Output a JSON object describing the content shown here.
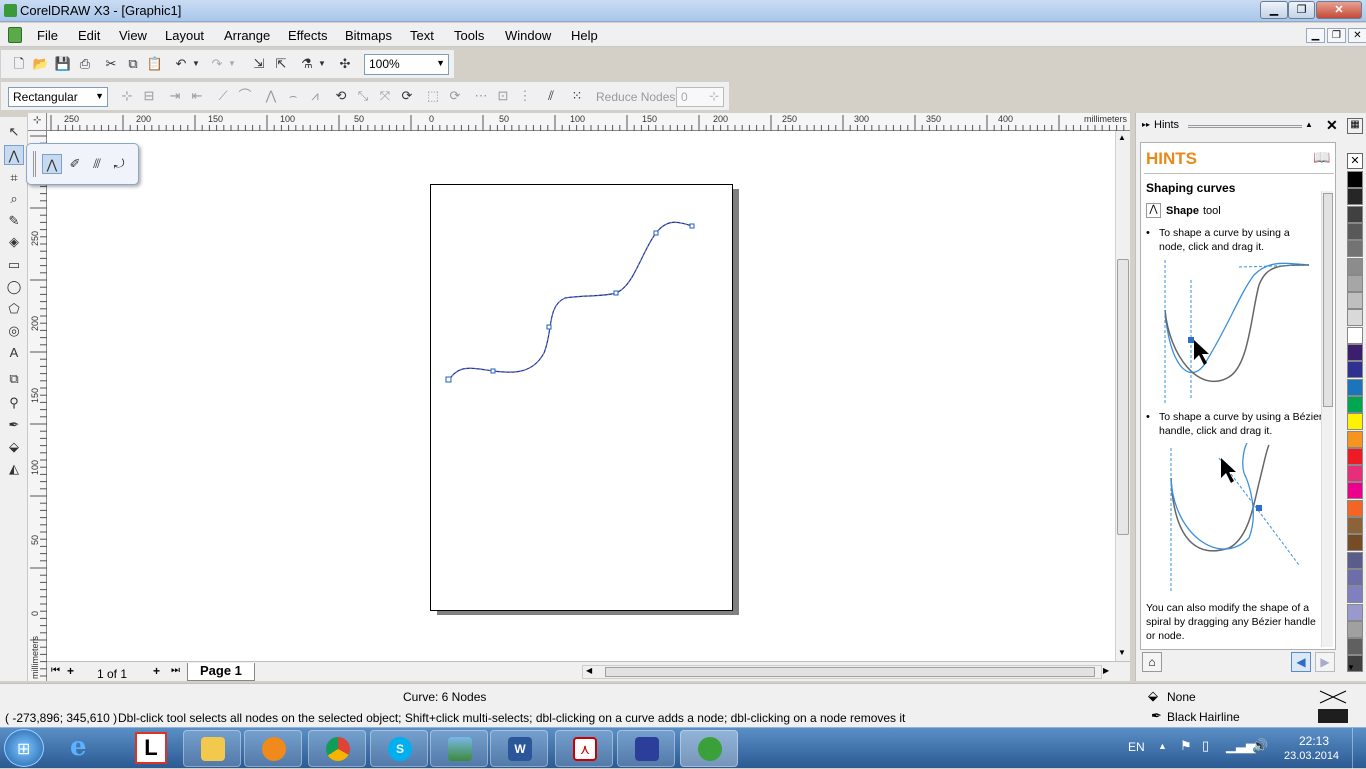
{
  "window": {
    "title": "CorelDRAW X3 - [Graphic1]"
  },
  "menu": [
    "File",
    "Edit",
    "View",
    "Layout",
    "Arrange",
    "Effects",
    "Bitmaps",
    "Text",
    "Tools",
    "Window",
    "Help"
  ],
  "toolbar": {
    "zoom": "100%",
    "selection_mode": "Rectangular",
    "reduce_nodes": "Reduce Nodes",
    "reduce_value": "0"
  },
  "ruler": {
    "unit": "millimeters",
    "top_ticks": [
      "250",
      "200",
      "150",
      "100",
      "50",
      "0",
      "50",
      "100",
      "150",
      "200",
      "250",
      "300",
      "350",
      "400"
    ],
    "left_ticks": [
      "250",
      "200",
      "150",
      "100",
      "50",
      "0"
    ]
  },
  "page_nav": {
    "counter": "1 of 1",
    "page_tab": "Page 1"
  },
  "docker": {
    "tab": "Hints",
    "heading": "HINTS",
    "topic": "Shaping curves",
    "tool_name": "Shape",
    "tool_suffix": "tool",
    "bullet1": "To shape a curve by using a node, click and drag it.",
    "bullet2": "To shape a curve by using a Bézier handle, click and drag it.",
    "footer_text": "You can also modify the shape of a spiral by dragging any Bézier handle or node."
  },
  "palette": [
    "#000000",
    "#262626",
    "#404040",
    "#595959",
    "#737373",
    "#8c8c8c",
    "#a6a6a6",
    "#bfbfbf",
    "#d9d9d9",
    "#ffffff",
    "#3b1f6e",
    "#2e3192",
    "#1b75bc",
    "#00a651",
    "#fff200",
    "#f7941d",
    "#ed1c24",
    "#e62e7b",
    "#ec008c",
    "#f26522",
    "#8c6239",
    "#754c24",
    "#5c5c8a",
    "#6d6daa",
    "#8080c0",
    "#9999cc",
    "#a0a0a0",
    "#606060",
    "#404040"
  ],
  "status": {
    "center": "Curve: 6 Nodes",
    "coords": "( -273,896; 345,610 )",
    "hint": "Dbl-click tool selects all nodes on the selected object; Shift+click multi-selects; dbl-clicking on a curve adds a node; dbl-clicking on a node removes it",
    "fill": "None",
    "outline_color": "Black",
    "outline_width": "Hairline"
  },
  "tray": {
    "lang": "EN",
    "time": "22:13",
    "date": "23.03.2014"
  }
}
